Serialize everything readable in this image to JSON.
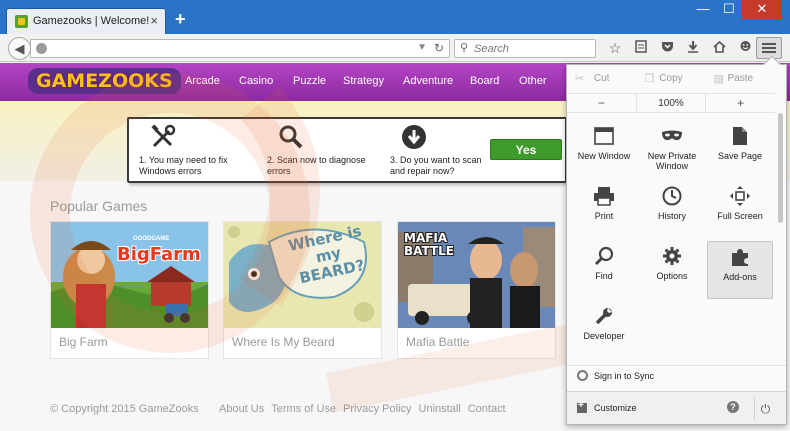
{
  "browser": {
    "tab_title": "Gamezooks | Welcome!",
    "tab_close": "×",
    "new_tab": "+",
    "search_placeholder": "Search",
    "window_buttons": [
      "—",
      "☐",
      "✕"
    ]
  },
  "site": {
    "logo_text": "GAMEZOOKS",
    "nav": [
      "Arcade",
      "Casino",
      "Puzzle",
      "Strategy",
      "Adventure",
      "Board",
      "Other"
    ],
    "banner": {
      "steps": [
        "1. You may need to fix Windows errors",
        "2. Scan now to diagnose errors",
        "3. Do you want to scan and repair now?"
      ],
      "button": "Yes"
    },
    "section_title": "Popular Games",
    "games": [
      {
        "name": "Big Farm",
        "thumb_text": "BigFarm",
        "thumb_sub": "GOODGAME"
      },
      {
        "name": "Where Is My Beard",
        "thumb_text": "Where is my BEARD?"
      },
      {
        "name": "Mafia Battle",
        "thumb_text": "MAFIA BATTLE"
      }
    ],
    "footer": {
      "copyright": "© Copyright 2015 GameZooks",
      "links": [
        "About Us",
        "Terms of Use",
        "Privacy Policy",
        "Uninstall",
        "Contact"
      ]
    }
  },
  "menu": {
    "edit": [
      "Cut",
      "Copy",
      "Paste"
    ],
    "zoom": {
      "minus": "−",
      "value": "100%",
      "plus": "+"
    },
    "items": [
      {
        "label": "New Window",
        "icon": "window-icon"
      },
      {
        "label": "New Private Window",
        "icon": "mask-icon"
      },
      {
        "label": "Save Page",
        "icon": "page-icon"
      },
      {
        "label": "Print",
        "icon": "printer-icon"
      },
      {
        "label": "History",
        "icon": "clock-icon"
      },
      {
        "label": "Full Screen",
        "icon": "fullscreen-icon"
      },
      {
        "label": "Find",
        "icon": "search-icon"
      },
      {
        "label": "Options",
        "icon": "gear-icon"
      },
      {
        "label": "Add-ons",
        "icon": "puzzle-icon"
      },
      {
        "label": "Developer",
        "icon": "wrench-icon"
      }
    ],
    "sync": "Sign in to Sync",
    "customize": "Customize",
    "help": "?"
  },
  "colors": {
    "titlebar": "#2b73c7",
    "site_nav": "#9b35b0",
    "yes_button": "#3f9a2c",
    "watermark": "#e8602a"
  }
}
